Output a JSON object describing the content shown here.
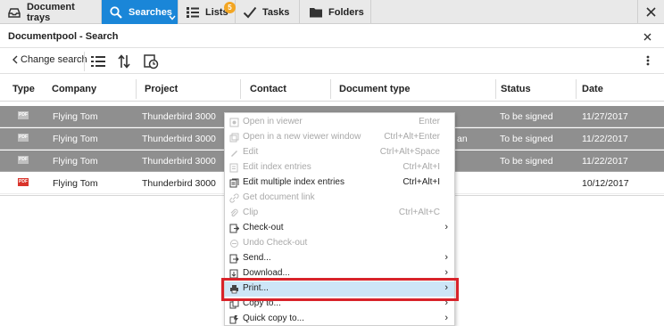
{
  "topbar": {
    "tabs": [
      {
        "label": "Document trays",
        "icon": "inbox-tray-icon"
      },
      {
        "label": "Searches",
        "icon": "search-icon"
      },
      {
        "label": "Lists",
        "icon": "list-icon"
      },
      {
        "label": "Tasks",
        "icon": "checkmark-icon"
      },
      {
        "label": "Folders",
        "icon": "folder-icon"
      }
    ],
    "lists_badge": "5"
  },
  "panel": {
    "title": "Documentpool - Search"
  },
  "toolbar": {
    "back_label": "Change search"
  },
  "table": {
    "columns": [
      "Type",
      "Company",
      "Project",
      "Contact",
      "Document type",
      "Status",
      "Date"
    ],
    "rows": [
      {
        "type": "PDF",
        "company": "Flying Tom",
        "project": "Thunderbird 3000",
        "doctype_tail": "",
        "status": "To be signed",
        "date": "11/27/2017",
        "selected": true
      },
      {
        "type": "PDF",
        "company": "Flying Tom",
        "project": "Thunderbird 3000",
        "doctype_tail": "an",
        "status": "To be signed",
        "date": "11/22/2017",
        "selected": true
      },
      {
        "type": "PDF",
        "company": "Flying Tom",
        "project": "Thunderbird 3000",
        "doctype_tail": "",
        "status": "To be signed",
        "date": "11/22/2017",
        "selected": true
      },
      {
        "type": "PDF",
        "company": "Flying Tom",
        "project": "Thunderbird 3000",
        "doctype_tail": "",
        "status": "",
        "date": "10/12/2017",
        "selected": false
      }
    ]
  },
  "context_menu": {
    "items": [
      {
        "label": "Open in viewer",
        "shortcut": "Enter",
        "enabled": false,
        "submenu": false
      },
      {
        "label": "Open in a new viewer window",
        "shortcut": "Ctrl+Alt+Enter",
        "enabled": false,
        "submenu": false
      },
      {
        "label": "Edit",
        "shortcut": "Ctrl+Alt+Space",
        "enabled": false,
        "submenu": false
      },
      {
        "label": "Edit index entries",
        "shortcut": "Ctrl+Alt+I",
        "enabled": false,
        "submenu": false
      },
      {
        "label": "Edit multiple index entries",
        "shortcut": "Ctrl+Alt+I",
        "enabled": true,
        "submenu": false
      },
      {
        "label": "Get document link",
        "shortcut": "",
        "enabled": false,
        "submenu": false
      },
      {
        "label": "Clip",
        "shortcut": "Ctrl+Alt+C",
        "enabled": false,
        "submenu": false
      },
      {
        "label": "Check-out",
        "shortcut": "",
        "enabled": true,
        "submenu": true
      },
      {
        "label": "Undo Check-out",
        "shortcut": "",
        "enabled": false,
        "submenu": false
      },
      {
        "label": "Send...",
        "shortcut": "",
        "enabled": true,
        "submenu": true
      },
      {
        "label": "Download...",
        "shortcut": "",
        "enabled": true,
        "submenu": true
      },
      {
        "label": "Print...",
        "shortcut": "",
        "enabled": true,
        "submenu": true,
        "highlighted": true
      },
      {
        "label": "Copy to...",
        "shortcut": "",
        "enabled": true,
        "submenu": true
      },
      {
        "label": "Quick copy to...",
        "shortcut": "",
        "enabled": true,
        "submenu": true
      }
    ],
    "submenu_arrow": "›"
  },
  "colors": {
    "accent": "#1a86d8",
    "badge": "#f3a623",
    "highlight_box": "#d8232a",
    "selected_row": "#8f8f8f",
    "hover_item": "#cde6f7"
  }
}
